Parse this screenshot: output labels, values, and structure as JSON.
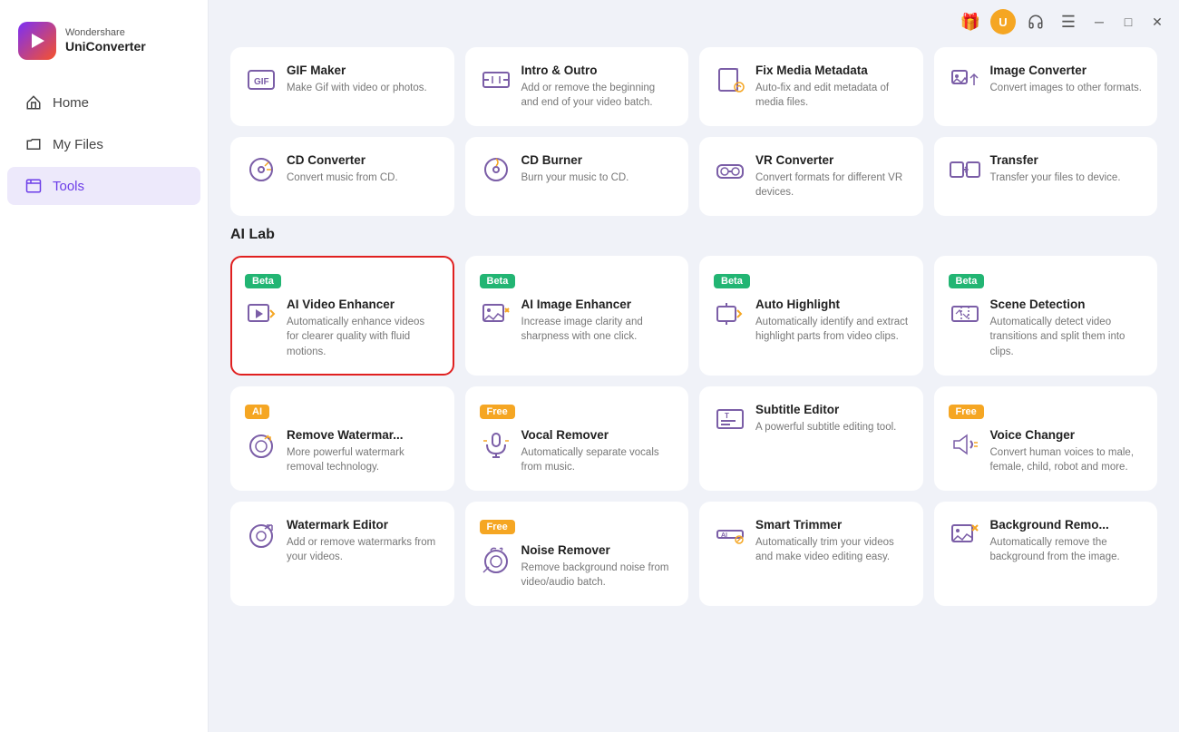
{
  "app": {
    "brand": "Wondershare",
    "product": "UniConverter"
  },
  "titlebar": {
    "gift_icon": "🎁",
    "avatar_label": "U",
    "headset_icon": "🎧",
    "menu_icon": "☰",
    "minimize_icon": "─",
    "maximize_icon": "□",
    "close_icon": "✕"
  },
  "sidebar": {
    "items": [
      {
        "id": "home",
        "label": "Home",
        "icon": "home"
      },
      {
        "id": "myfiles",
        "label": "My Files",
        "icon": "folder"
      },
      {
        "id": "tools",
        "label": "Tools",
        "icon": "tools",
        "active": true
      }
    ]
  },
  "tools_section": {
    "title": "",
    "cards": [
      {
        "id": "gif-maker",
        "badge": null,
        "name": "GIF Maker",
        "desc": "Make Gif with video or photos.",
        "icon": "gif"
      },
      {
        "id": "intro-outro",
        "badge": null,
        "name": "Intro & Outro",
        "desc": "Add or remove the beginning and end of your video batch.",
        "icon": "intro"
      },
      {
        "id": "fix-media-metadata",
        "badge": null,
        "name": "Fix Media Metadata",
        "desc": "Auto-fix and edit metadata of media files.",
        "icon": "metadata"
      },
      {
        "id": "image-converter",
        "badge": null,
        "name": "Image Converter",
        "desc": "Convert images to other formats.",
        "icon": "image-convert"
      },
      {
        "id": "cd-converter",
        "badge": null,
        "name": "CD Converter",
        "desc": "Convert music from CD.",
        "icon": "cd"
      },
      {
        "id": "cd-burner",
        "badge": null,
        "name": "CD Burner",
        "desc": "Burn your music to CD.",
        "icon": "cd-burn"
      },
      {
        "id": "vr-converter",
        "badge": null,
        "name": "VR Converter",
        "desc": "Convert formats for different VR devices.",
        "icon": "vr"
      },
      {
        "id": "transfer",
        "badge": null,
        "name": "Transfer",
        "desc": "Transfer your files to device.",
        "icon": "transfer"
      }
    ]
  },
  "ailab_section": {
    "title": "AI Lab",
    "cards": [
      {
        "id": "ai-video-enhancer",
        "badge": "Beta",
        "badge_type": "beta",
        "name": "AI Video Enhancer",
        "desc": "Automatically enhance videos for clearer quality with fluid motions.",
        "icon": "video-enhance",
        "highlighted": true
      },
      {
        "id": "ai-image-enhancer",
        "badge": "Beta",
        "badge_type": "beta",
        "name": "AI Image Enhancer",
        "desc": "Increase image clarity and sharpness with one click.",
        "icon": "image-enhance",
        "highlighted": false
      },
      {
        "id": "auto-highlight",
        "badge": "Beta",
        "badge_type": "beta",
        "name": "Auto Highlight",
        "desc": "Automatically identify and extract highlight parts from video clips.",
        "icon": "highlight",
        "highlighted": false
      },
      {
        "id": "scene-detection",
        "badge": "Beta",
        "badge_type": "beta",
        "name": "Scene Detection",
        "desc": "Automatically detect video transitions and split them into clips.",
        "icon": "scene",
        "highlighted": false
      },
      {
        "id": "remove-watermark",
        "badge": "AI",
        "badge_type": "ai",
        "name": "Remove Watermar...",
        "desc": "More powerful watermark removal technology.",
        "icon": "watermark-remove",
        "highlighted": false
      },
      {
        "id": "vocal-remover",
        "badge": "Free",
        "badge_type": "free",
        "name": "Vocal Remover",
        "desc": "Automatically separate vocals from music.",
        "icon": "vocal",
        "highlighted": false
      },
      {
        "id": "subtitle-editor",
        "badge": null,
        "name": "Subtitle Editor",
        "desc": "A powerful subtitle editing tool.",
        "icon": "subtitle",
        "highlighted": false
      },
      {
        "id": "voice-changer",
        "badge": "Free",
        "badge_type": "free",
        "name": "Voice Changer",
        "desc": "Convert human voices to male, female, child, robot and more.",
        "icon": "voice-change",
        "highlighted": false
      },
      {
        "id": "watermark-editor",
        "badge": null,
        "name": "Watermark Editor",
        "desc": "Add or remove watermarks from your videos.",
        "icon": "watermark-edit",
        "highlighted": false
      },
      {
        "id": "noise-remover",
        "badge": "Free",
        "badge_type": "free",
        "name": "Noise Remover",
        "desc": "Remove background noise from video/audio batch.",
        "icon": "noise",
        "highlighted": false
      },
      {
        "id": "smart-trimmer",
        "badge": null,
        "name": "Smart Trimmer",
        "desc": "Automatically trim your videos and make video editing easy.",
        "icon": "trim",
        "highlighted": false
      },
      {
        "id": "background-remover",
        "badge": null,
        "name": "Background Remo...",
        "desc": "Automatically remove the background from the image.",
        "icon": "bg-remove",
        "highlighted": false
      }
    ]
  }
}
